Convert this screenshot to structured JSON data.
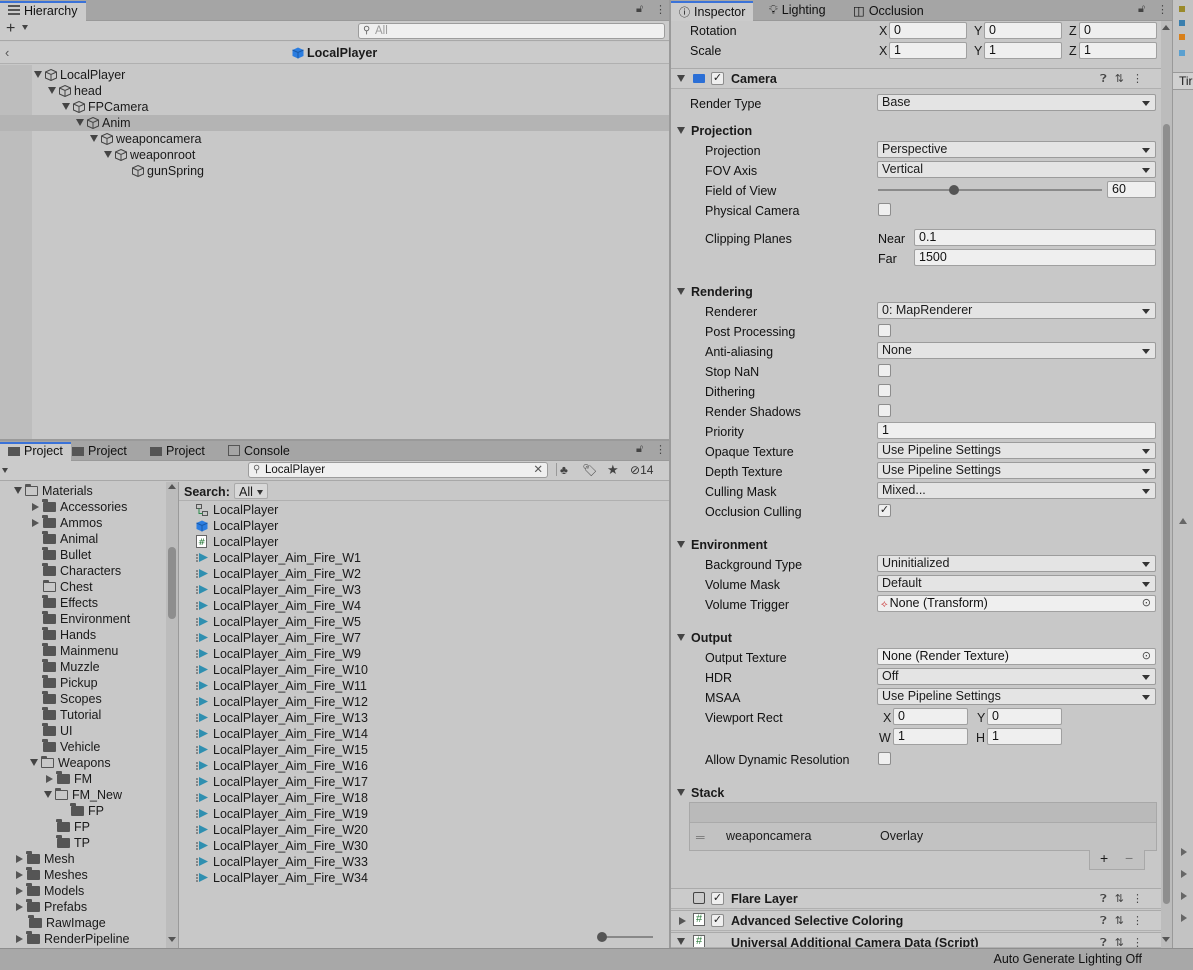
{
  "hierarchy": {
    "tab_label": "Hierarchy",
    "search_placeholder": "All",
    "breadcrumb_title": "LocalPlayer",
    "items": [
      {
        "label": "LocalPlayer"
      },
      {
        "label": "head"
      },
      {
        "label": "FPCamera"
      },
      {
        "label": "Anim"
      },
      {
        "label": "weaponcamera"
      },
      {
        "label": "weaponroot"
      },
      {
        "label": "gunSpring"
      }
    ]
  },
  "project": {
    "tabs": [
      {
        "label": "Project"
      },
      {
        "label": "Project"
      },
      {
        "label": "Project"
      },
      {
        "label": "Console"
      }
    ],
    "search_value": "LocalPlayer",
    "hidden_count": "14",
    "search_filter_label": "Search:",
    "search_filter_value": "All",
    "folders": [
      {
        "label": "Materials"
      },
      {
        "label": "Accessories"
      },
      {
        "label": "Ammos"
      },
      {
        "label": "Animal"
      },
      {
        "label": "Bullet"
      },
      {
        "label": "Characters"
      },
      {
        "label": "Chest"
      },
      {
        "label": "Effects"
      },
      {
        "label": "Environment"
      },
      {
        "label": "Hands"
      },
      {
        "label": "Mainmenu"
      },
      {
        "label": "Muzzle"
      },
      {
        "label": "Pickup"
      },
      {
        "label": "Scopes"
      },
      {
        "label": "Tutorial"
      },
      {
        "label": "UI"
      },
      {
        "label": "Vehicle"
      },
      {
        "label": "Weapons"
      },
      {
        "label": "FM"
      },
      {
        "label": "FM_New"
      },
      {
        "label": "FP"
      },
      {
        "label": "FP"
      },
      {
        "label": "TP"
      },
      {
        "label": "Mesh"
      },
      {
        "label": "Meshes"
      },
      {
        "label": "Models"
      },
      {
        "label": "Prefabs"
      },
      {
        "label": "RawImage"
      },
      {
        "label": "RenderPipeline"
      }
    ],
    "results": [
      {
        "label": "LocalPlayer",
        "icon": "animator-controller-icon"
      },
      {
        "label": "LocalPlayer",
        "icon": "prefab-icon"
      },
      {
        "label": "LocalPlayer",
        "icon": "script-icon"
      },
      {
        "label": "LocalPlayer_Aim_Fire_W1",
        "icon": "anim-clip-icon"
      },
      {
        "label": "LocalPlayer_Aim_Fire_W2",
        "icon": "anim-clip-icon"
      },
      {
        "label": "LocalPlayer_Aim_Fire_W3",
        "icon": "anim-clip-icon"
      },
      {
        "label": "LocalPlayer_Aim_Fire_W4",
        "icon": "anim-clip-icon"
      },
      {
        "label": "LocalPlayer_Aim_Fire_W5",
        "icon": "anim-clip-icon"
      },
      {
        "label": "LocalPlayer_Aim_Fire_W7",
        "icon": "anim-clip-icon"
      },
      {
        "label": "LocalPlayer_Aim_Fire_W9",
        "icon": "anim-clip-icon"
      },
      {
        "label": "LocalPlayer_Aim_Fire_W10",
        "icon": "anim-clip-icon"
      },
      {
        "label": "LocalPlayer_Aim_Fire_W11",
        "icon": "anim-clip-icon"
      },
      {
        "label": "LocalPlayer_Aim_Fire_W12",
        "icon": "anim-clip-icon"
      },
      {
        "label": "LocalPlayer_Aim_Fire_W13",
        "icon": "anim-clip-icon"
      },
      {
        "label": "LocalPlayer_Aim_Fire_W14",
        "icon": "anim-clip-icon"
      },
      {
        "label": "LocalPlayer_Aim_Fire_W15",
        "icon": "anim-clip-icon"
      },
      {
        "label": "LocalPlayer_Aim_Fire_W16",
        "icon": "anim-clip-icon"
      },
      {
        "label": "LocalPlayer_Aim_Fire_W17",
        "icon": "anim-clip-icon"
      },
      {
        "label": "LocalPlayer_Aim_Fire_W18",
        "icon": "anim-clip-icon"
      },
      {
        "label": "LocalPlayer_Aim_Fire_W19",
        "icon": "anim-clip-icon"
      },
      {
        "label": "LocalPlayer_Aim_Fire_W20",
        "icon": "anim-clip-icon"
      },
      {
        "label": "LocalPlayer_Aim_Fire_W30",
        "icon": "anim-clip-icon"
      },
      {
        "label": "LocalPlayer_Aim_Fire_W33",
        "icon": "anim-clip-icon"
      },
      {
        "label": "LocalPlayer_Aim_Fire_W34",
        "icon": "anim-clip-icon"
      }
    ]
  },
  "inspector": {
    "tabs": [
      {
        "label": "Inspector"
      },
      {
        "label": "Lighting"
      },
      {
        "label": "Occlusion"
      }
    ],
    "transform": {
      "rotation_label": "Rotation",
      "scale_label": "Scale",
      "rotation": {
        "x": "0",
        "y": "0",
        "z": "0"
      },
      "scale": {
        "x": "1",
        "y": "1",
        "z": "1"
      },
      "x": "X",
      "y": "Y",
      "z": "Z"
    },
    "camera": {
      "title": "Camera",
      "render_type_label": "Render Type",
      "render_type": "Base",
      "projection_section": "Projection",
      "projection_label": "Projection",
      "projection": "Perspective",
      "fov_axis_label": "FOV Axis",
      "fov_axis": "Vertical",
      "fov_label": "Field of View",
      "fov_value": "60",
      "fov_fraction": 0.34,
      "physical_camera_label": "Physical Camera",
      "clipping_label": "Clipping Planes",
      "near_label": "Near",
      "near": "0.1",
      "far_label": "Far",
      "far": "1500",
      "rendering_section": "Rendering",
      "renderer_label": "Renderer",
      "renderer": "0: MapRenderer",
      "post_processing_label": "Post Processing",
      "anti_aliasing_label": "Anti-aliasing",
      "anti_aliasing": "None",
      "stop_nan_label": "Stop NaN",
      "dithering_label": "Dithering",
      "render_shadows_label": "Render Shadows",
      "priority_label": "Priority",
      "priority": "1",
      "opaque_texture_label": "Opaque Texture",
      "opaque_texture": "Use Pipeline Settings",
      "depth_texture_label": "Depth Texture",
      "depth_texture": "Use Pipeline Settings",
      "culling_mask_label": "Culling Mask",
      "culling_mask": "Mixed...",
      "occlusion_culling_label": "Occlusion Culling",
      "environment_section": "Environment",
      "background_type_label": "Background Type",
      "background_type": "Uninitialized",
      "volume_mask_label": "Volume Mask",
      "volume_mask": "Default",
      "volume_trigger_label": "Volume Trigger",
      "volume_trigger": "None (Transform)",
      "output_section": "Output",
      "output_texture_label": "Output Texture",
      "output_texture": "None (Render Texture)",
      "hdr_label": "HDR",
      "hdr": "Off",
      "msaa_label": "MSAA",
      "msaa": "Use Pipeline Settings",
      "viewport_label": "Viewport Rect",
      "viewport": {
        "x": "0",
        "y": "0",
        "w": "1",
        "h": "1"
      },
      "viewport_letters": {
        "x": "X",
        "y": "Y",
        "w": "W",
        "h": "H"
      },
      "dynamic_res_label": "Allow Dynamic Resolution",
      "stack_section": "Stack",
      "stack_item_name": "weaponcamera",
      "stack_item_type": "Overlay",
      "add": "+",
      "remove": "−"
    },
    "components": [
      {
        "title": "Flare Layer"
      },
      {
        "title": "Advanced Selective Coloring"
      },
      {
        "title": "Universal Additional Camera Data (Script)"
      }
    ]
  },
  "right_edge": {
    "label": "Tir"
  },
  "status": {
    "text": "Auto Generate Lighting Off"
  },
  "colors": {
    "accent": "#3a72d8",
    "panel": "#c8c8c8",
    "tab": "#a5a5a5"
  }
}
